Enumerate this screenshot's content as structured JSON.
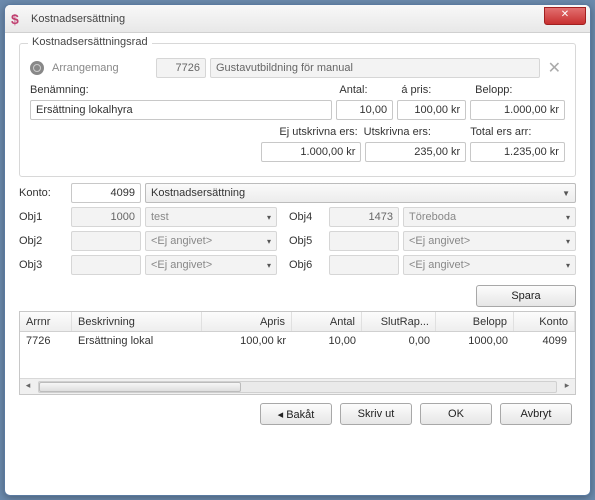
{
  "window": {
    "title": "Kostnadsersättning"
  },
  "fieldset": {
    "legend": "Kostnadsersättningsrad",
    "arrangemang_label": "Arrangemang",
    "arrangemang_id": "7726",
    "arrangemang_name": "Gustavutbildning för manual",
    "benamning_label": "Benämning:",
    "benamning_value": "Ersättning lokalhyra",
    "antal_label": "Antal:",
    "antal_value": "10,00",
    "apris_label": "á pris:",
    "apris_value": "100,00 kr",
    "belopp_label": "Belopp:",
    "belopp_value": "1.000,00 kr",
    "ej_utskrivna_label": "Ej utskrivna ers:",
    "ej_utskrivna_value": "1.000,00 kr",
    "utskrivna_label": "Utskrivna ers:",
    "utskrivna_value": "235,00 kr",
    "total_label": "Total ers arr:",
    "total_value": "1.235,00 kr"
  },
  "konto": {
    "label": "Konto:",
    "code": "4099",
    "name": "Kostnadsersättning"
  },
  "obj": {
    "obj1": {
      "label": "Obj1",
      "code": "1000",
      "name": "test"
    },
    "obj2": {
      "label": "Obj2",
      "code": "",
      "name": "<Ej angivet>"
    },
    "obj3": {
      "label": "Obj3",
      "code": "",
      "name": "<Ej angivet>"
    },
    "obj4": {
      "label": "Obj4",
      "code": "1473",
      "name": "Töreboda"
    },
    "obj5": {
      "label": "Obj5",
      "code": "",
      "name": "<Ej angivet>"
    },
    "obj6": {
      "label": "Obj6",
      "code": "",
      "name": "<Ej angivet>"
    }
  },
  "buttons": {
    "spara": "Spara",
    "bakat": "◂ Bakåt",
    "skrivut": "Skriv ut",
    "ok": "OK",
    "avbryt": "Avbryt"
  },
  "grid": {
    "headers": {
      "arrnr": "Arrnr",
      "beskrivning": "Beskrivning",
      "apris": "Apris",
      "antal": "Antal",
      "slutrap": "SlutRap...",
      "belopp": "Belopp",
      "konto": "Konto"
    },
    "row": {
      "arrnr": "7726",
      "beskrivning": "Ersättning lokal",
      "apris": "100,00 kr",
      "antal": "10,00",
      "slutrap": "0,00",
      "belopp": "1000,00",
      "konto": "4099"
    }
  }
}
